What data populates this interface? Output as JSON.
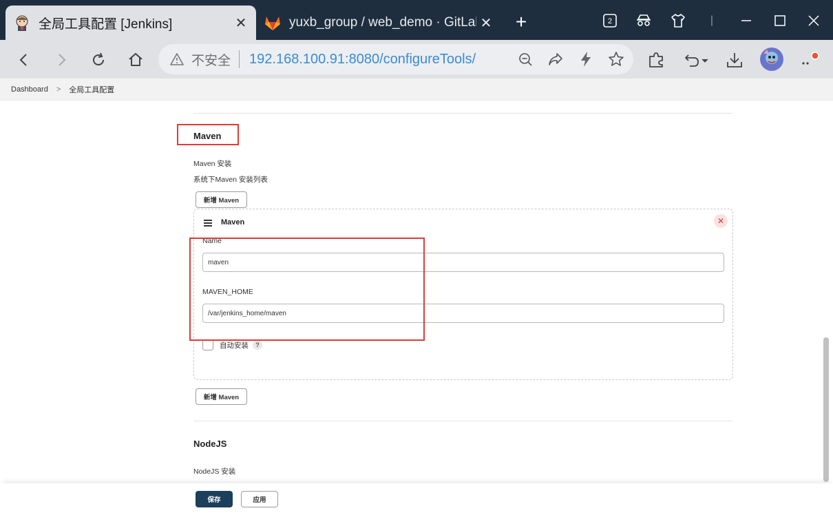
{
  "browser": {
    "tabs": [
      {
        "title": "全局工具配置 [Jenkins]",
        "active": true,
        "icon": "jenkins-icon"
      },
      {
        "title": "yuxb_group / web_demo · GitLab",
        "active": false,
        "icon": "gitlab-icon"
      }
    ],
    "tab_counter": "2",
    "insecure_label": "不安全",
    "url": "192.168.100.91:8080/configureTools/"
  },
  "breadcrumb": {
    "items": [
      "Dashboard",
      "全局工具配置"
    ],
    "separator": ">"
  },
  "maven": {
    "section_title": "Maven",
    "install_label": "Maven 安装",
    "install_desc": "系统下Maven 安装列表",
    "add_button": "新增 Maven",
    "installation": {
      "title": "Maven",
      "name_label": "Name",
      "name_value": "maven",
      "home_label": "MAVEN_HOME",
      "home_value": "/var/jenkins_home/maven",
      "auto_install_label": "自动安装",
      "auto_install_checked": false,
      "help": "?"
    },
    "add_button_bottom": "新增 Maven"
  },
  "nodejs": {
    "section_title": "NodeJS",
    "install_label": "NodeJS 安装"
  },
  "footer": {
    "save_label": "保存",
    "apply_label": "应用"
  },
  "colors": {
    "tabbar_bg": "#1e2e3f",
    "url_color": "#3a8bd6",
    "save_button_bg": "#1c3f5c",
    "annotation_red": "#e03a3a"
  }
}
